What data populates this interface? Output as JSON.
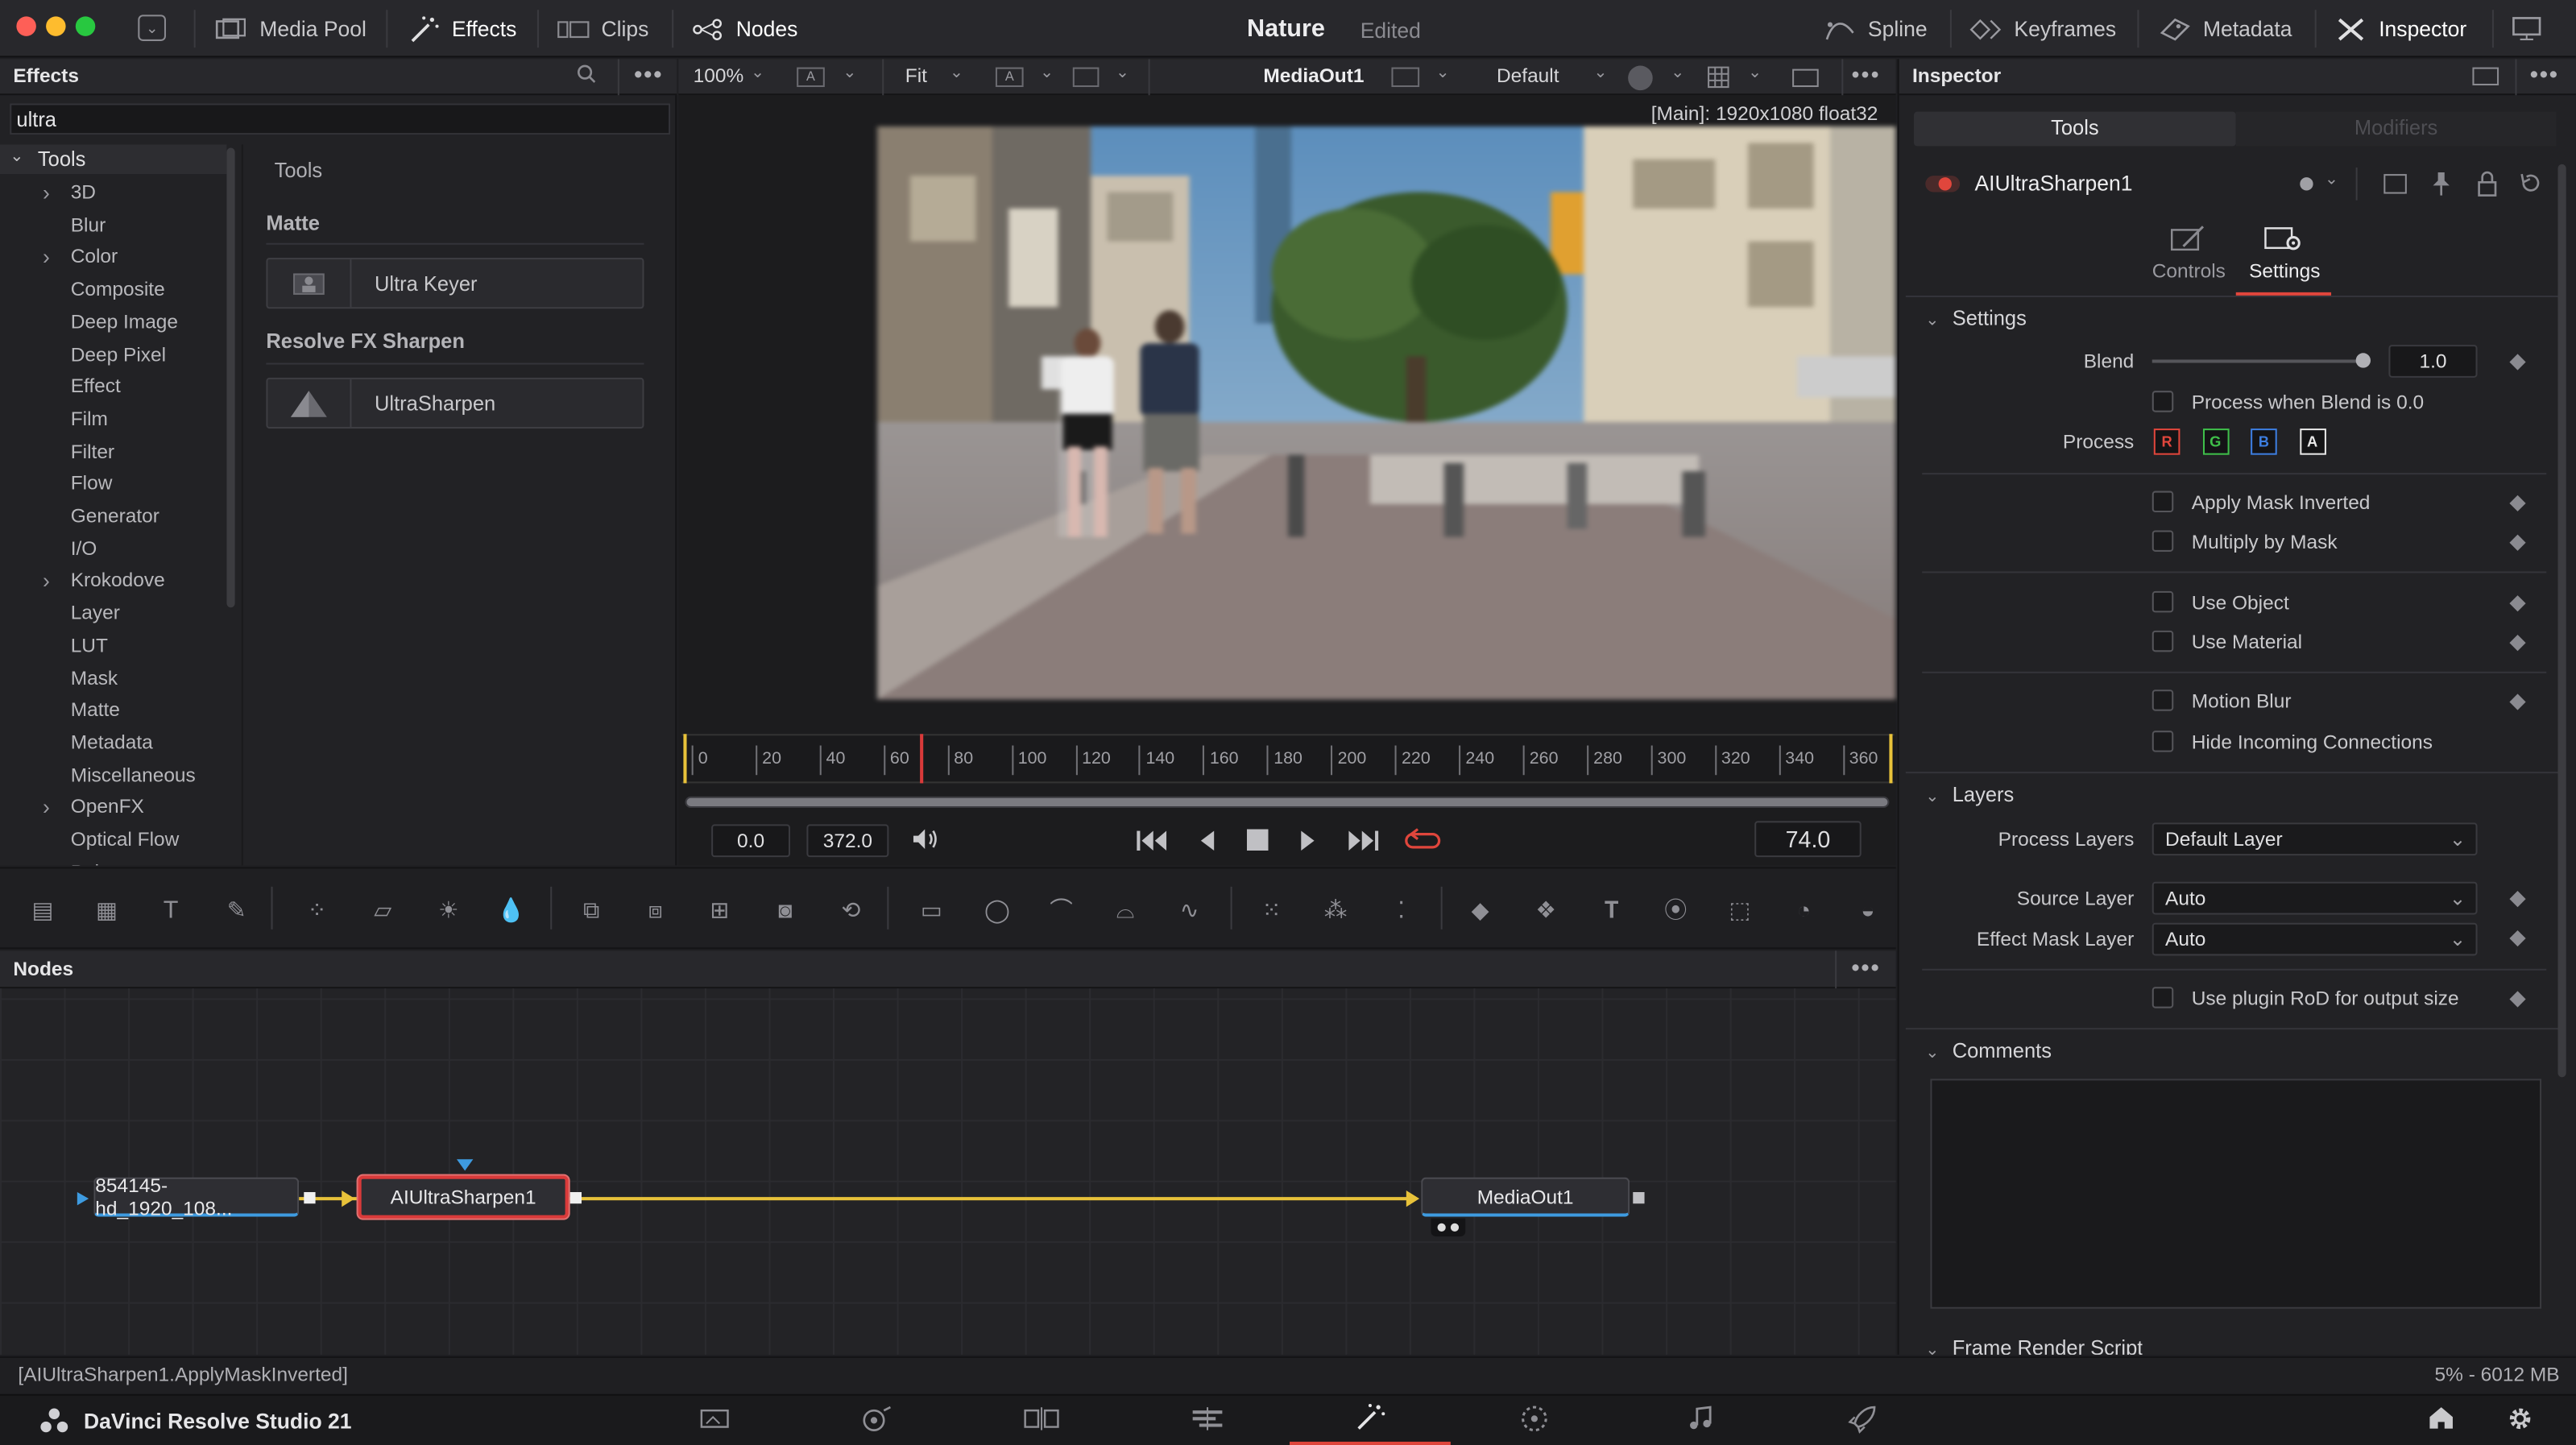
{
  "topbar": {
    "media_pool": "Media Pool",
    "effects": "Effects",
    "clips": "Clips",
    "nodes": "Nodes",
    "project_title": "Nature",
    "project_status": "Edited",
    "spline": "Spline",
    "keyframes": "Keyframes",
    "metadata": "Metadata",
    "inspector": "Inspector"
  },
  "effects_panel": {
    "title": "Effects",
    "search_value": "ultra",
    "tree_root": "Tools",
    "tree_items": [
      "3D",
      "Blur",
      "Color",
      "Composite",
      "Deep Image",
      "Deep Pixel",
      "Effect",
      "Film",
      "Filter",
      "Flow",
      "Generator",
      "I/O",
      "Krokodove",
      "Layer",
      "LUT",
      "Mask",
      "Matte",
      "Metadata",
      "Miscellaneous",
      "OpenFX",
      "Optical Flow",
      "Paint"
    ],
    "results_header": "Tools",
    "groups": [
      {
        "name": "Matte",
        "item": "Ultra Keyer"
      },
      {
        "name": "Resolve FX Sharpen",
        "item": "UltraSharpen"
      }
    ]
  },
  "viewer": {
    "zoom": "100%",
    "fit": "Fit",
    "output": "MediaOut1",
    "lut": "Default",
    "info": "[Main]: 1920x1080 float32",
    "ruler": [
      "0",
      "20",
      "40",
      "60",
      "80",
      "100",
      "120",
      "140",
      "160",
      "180",
      "200",
      "220",
      "240",
      "260",
      "280",
      "300",
      "320",
      "340",
      "360"
    ],
    "playhead_frame": 74,
    "range_max": 372,
    "start": "0.0",
    "end": "372.0",
    "current": "74.0"
  },
  "nodes_panel": {
    "title": "Nodes",
    "node_source": "854145-hd_1920_108...",
    "node_effect": "AIUltraSharpen1",
    "node_output": "MediaOut1"
  },
  "inspector": {
    "title": "Inspector",
    "tab_tools": "Tools",
    "tab_modifiers": "Modifiers",
    "node_name": "AIUltraSharpen1",
    "subtab_controls": "Controls",
    "subtab_settings": "Settings",
    "section_settings": "Settings",
    "blend_label": "Blend",
    "blend_value": "1.0",
    "process_when_blend": "Process when Blend is 0.0",
    "process_label": "Process",
    "channels": [
      "R",
      "G",
      "B",
      "A"
    ],
    "channel_colors": [
      "#e0463c",
      "#3fbf4a",
      "#3d7ee0",
      "#e8e8e8"
    ],
    "apply_mask_inverted": "Apply Mask Inverted",
    "multiply_by_mask": "Multiply by Mask",
    "use_object": "Use Object",
    "use_material": "Use Material",
    "motion_blur": "Motion Blur",
    "hide_incoming": "Hide Incoming Connections",
    "section_layers": "Layers",
    "process_layers_label": "Process Layers",
    "process_layers_value": "Default Layer",
    "source_layer_label": "Source Layer",
    "source_layer_value": "Auto",
    "effect_mask_layer_label": "Effect Mask Layer",
    "effect_mask_layer_value": "Auto",
    "use_plugin_rod": "Use plugin RoD for output size",
    "section_comments": "Comments",
    "section_frame_render": "Frame Render Script"
  },
  "status": {
    "left": "[AIUltraSharpen1.ApplyMaskInverted]",
    "right": "5% - 6012 MB"
  },
  "bottombar": {
    "app_name": "DaVinci Resolve Studio 21"
  },
  "colors": {
    "accent_red": "#e0463c",
    "connection_yellow": "#e8c23a",
    "node_select": "#d93a3a"
  }
}
